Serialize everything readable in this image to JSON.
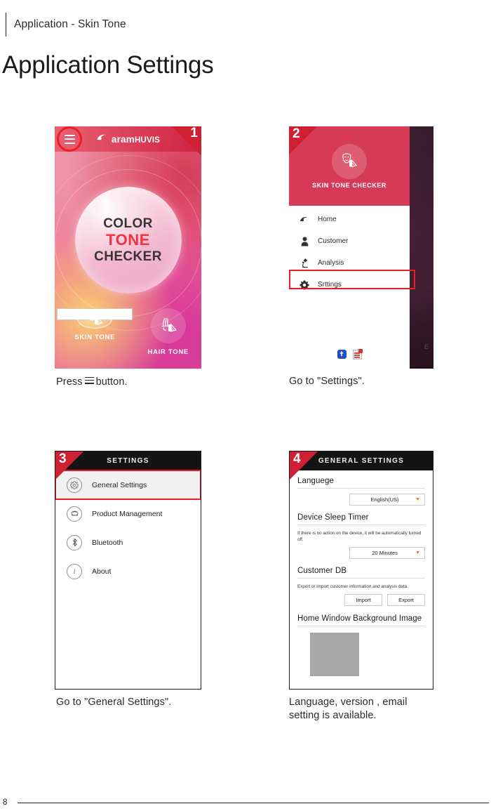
{
  "document": {
    "breadcrumb": "Application - Skin Tone",
    "title": "Application Settings",
    "page_number": "8"
  },
  "steps": [
    {
      "number": "1",
      "caption_before": "Press",
      "caption_icon": "hamburger-icon",
      "caption_after": "button.",
      "screen": {
        "brand_name": "aram",
        "brand_suffix": "HUVIS",
        "menu_icon": "hamburger-icon",
        "logo_icon": "swoosh-icon",
        "orb_line1": "COLOR",
        "orb_line2": "TONE",
        "orb_line3": "CHECKER",
        "modes": [
          {
            "label": "SKIN TONE",
            "icon": "face-palette-icon",
            "selected": true
          },
          {
            "label": "HAIR TONE",
            "icon": "hair-palette-icon",
            "selected": false
          }
        ]
      }
    },
    {
      "number": "2",
      "caption": "Go to \"Settings\".",
      "screen": {
        "drawer_title": "SKIN TONE CHECKER",
        "drawer_avatar_icon": "face-palette-icon",
        "items": [
          {
            "label": "Home",
            "icon": "swoosh-icon",
            "highlighted": false
          },
          {
            "label": "Customer",
            "icon": "person-icon",
            "highlighted": false
          },
          {
            "label": "Analysis",
            "icon": "microscope-icon",
            "highlighted": false
          },
          {
            "label": "Srttings",
            "icon": "gear-icon",
            "highlighted": true
          }
        ],
        "status_icons": [
          {
            "name": "bluetooth-icon",
            "glyph": "ᛗ"
          },
          {
            "name": "document-icon",
            "glyph": ""
          }
        ],
        "background_watermark": "E"
      }
    },
    {
      "number": "3",
      "caption": "Go to \"General Settings\".",
      "screen": {
        "bar_title": "SETTINGS",
        "items": [
          {
            "label": "General Settings",
            "icon": "gear-icon",
            "active": true
          },
          {
            "label": "Product Management",
            "icon": "product-icon",
            "active": false
          },
          {
            "label": "Bluetooth",
            "icon": "bluetooth-icon",
            "active": false
          },
          {
            "label": "About",
            "icon": "info-icon",
            "active": false
          }
        ]
      }
    },
    {
      "number": "4",
      "caption": "Language, version , email setting is available.",
      "screen": {
        "bar_title": "GENERAL SETTINGS",
        "sections": [
          {
            "heading": "Languege",
            "note": "",
            "control_type": "select",
            "value": "English(US)"
          },
          {
            "heading": "Device Sleep Timer",
            "note": "If there is no action on the device, it will be automatically turned off.",
            "control_type": "select",
            "value": "20 Minutes"
          },
          {
            "heading": "Customer DB",
            "note": "Export or import customer information and analysis data.",
            "control_type": "buttons",
            "buttons": [
              "Import",
              "Export"
            ]
          },
          {
            "heading": "Home Window Background Image",
            "note": "",
            "control_type": "thumbnail"
          }
        ]
      }
    }
  ],
  "colors": {
    "accent_red": "#ce2032",
    "highlight_red": "#ee1c25",
    "drawer_header": "#d63a56",
    "tone_red": "#ef3340",
    "dark_bar": "#141414"
  }
}
